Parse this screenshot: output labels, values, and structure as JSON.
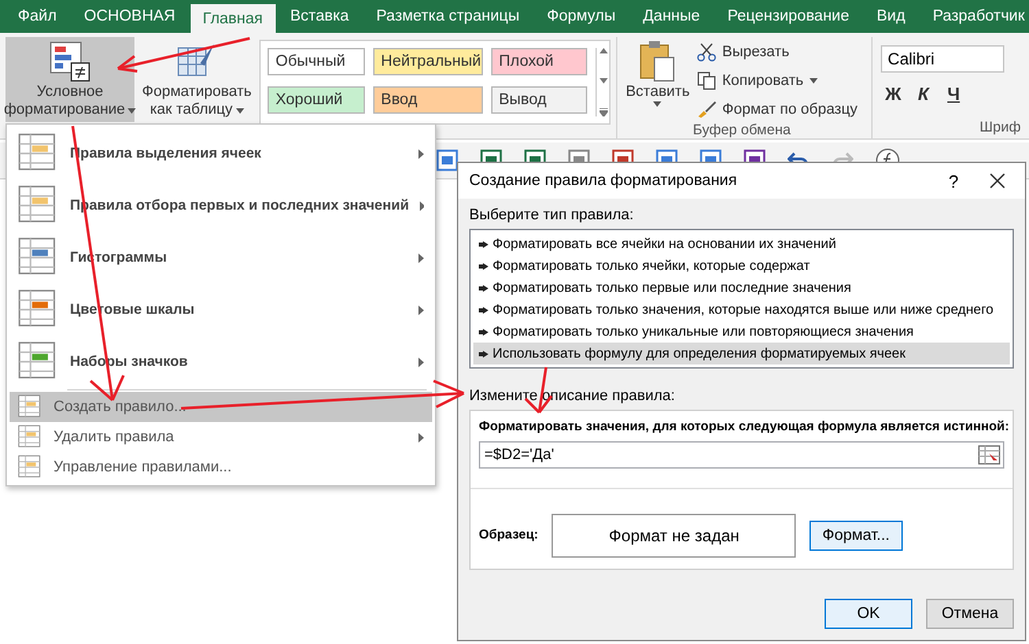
{
  "ribbon_tabs": [
    {
      "label": "Файл",
      "selected": false
    },
    {
      "label": "ОСНОВНАЯ",
      "selected": false
    },
    {
      "label": "Главная",
      "selected": true
    },
    {
      "label": "Вставка",
      "selected": false
    },
    {
      "label": "Разметка страницы",
      "selected": false
    },
    {
      "label": "Формулы",
      "selected": false
    },
    {
      "label": "Данные",
      "selected": false
    },
    {
      "label": "Рецензирование",
      "selected": false
    },
    {
      "label": "Вид",
      "selected": false
    },
    {
      "label": "Разработчик",
      "selected": false
    }
  ],
  "ribbon": {
    "conditional_formatting": {
      "label_lines": [
        "Условное",
        "форматирование"
      ],
      "selected": true
    },
    "format_as_table": {
      "label_lines": [
        "Форматировать",
        "как таблицу"
      ]
    },
    "styles": [
      {
        "label": "Обычный",
        "color": "#ffffff"
      },
      {
        "label": "Нейтральный",
        "color": "#ffeb9c"
      },
      {
        "label": "Плохой",
        "color": "#ffc7ce"
      },
      {
        "label": "Хороший",
        "color": "#c6efce"
      },
      {
        "label": "Ввод",
        "color": "#ffcc99"
      },
      {
        "label": "Вывод",
        "color": "#f2f2f2"
      }
    ],
    "clipboard": {
      "paste": "Вставить",
      "cut": "Вырезать",
      "copy": "Копировать",
      "format_painter": "Формат по образцу",
      "group_label": "Буфер обмена"
    },
    "font": {
      "font_name": "Calibri",
      "bold": "Ж",
      "italic": "К",
      "underline": "Ч",
      "group_label": "Шриф"
    }
  },
  "menu": {
    "items": [
      {
        "label": "Правила выделения ячеек",
        "kind": "large",
        "submenu": true,
        "selected": false
      },
      {
        "label": "Правила отбора первых и последних значений",
        "kind": "large",
        "submenu": true,
        "selected": false
      },
      {
        "label": "Гистограммы",
        "kind": "large",
        "submenu": true,
        "selected": false
      },
      {
        "label": "Цветовые шкалы",
        "kind": "large",
        "submenu": true,
        "selected": false
      },
      {
        "label": "Наборы значков",
        "kind": "large",
        "submenu": true,
        "selected": false
      },
      {
        "label": "Создать правило...",
        "kind": "small",
        "submenu": false,
        "selected": true
      },
      {
        "label": "Удалить правила",
        "kind": "small",
        "submenu": true,
        "selected": false
      },
      {
        "label": "Управление правилами...",
        "kind": "small",
        "submenu": false,
        "selected": false
      }
    ]
  },
  "dialog": {
    "title": "Создание правила форматирования",
    "help": "?",
    "rule_type_label": "Выберите тип правила:",
    "rule_types": [
      {
        "label": "Форматировать все ячейки на основании их значений",
        "selected": false
      },
      {
        "label": "Форматировать только ячейки, которые содержат",
        "selected": false
      },
      {
        "label": "Форматировать только первые или последние значения",
        "selected": false
      },
      {
        "label": "Форматировать только значения, которые находятся выше или ниже среднего",
        "selected": false
      },
      {
        "label": "Форматировать только уникальные или повторяющиеся значения",
        "selected": false
      },
      {
        "label": "Использовать формулу для определения форматируемых ячеек",
        "selected": true
      }
    ],
    "description_label": "Измените описание правила:",
    "formula_label": "Форматировать значения, для которых следующая формула является истинной:",
    "formula_value": "=$D2='Да'",
    "sample_label": "Образец:",
    "sample_text": "Формат не задан",
    "format_button": "Формат...",
    "ok_button": "OK",
    "cancel_button": "Отмена"
  }
}
